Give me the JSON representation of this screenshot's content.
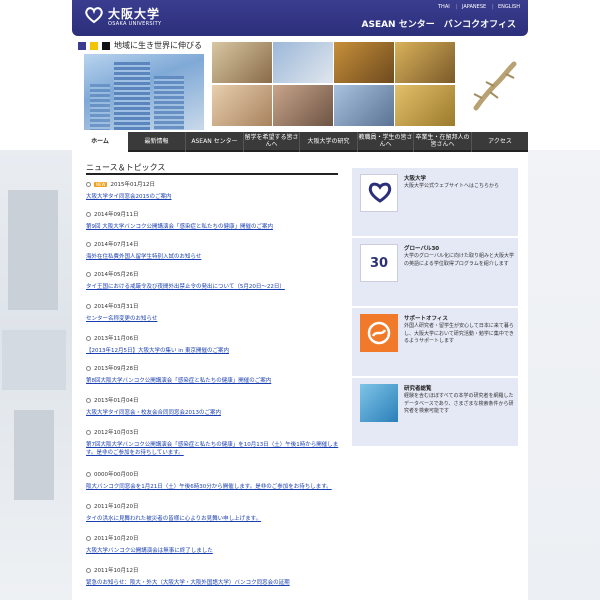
{
  "header": {
    "logo_ja": "大阪大学",
    "logo_en": "OSAKA UNIVERSITY",
    "lang_links": [
      "THAI",
      "JAPANESE",
      "ENGLISH"
    ],
    "title": "ASEAN センター　バンコクオフィス"
  },
  "hero": {
    "slogan": "地域に生き世界に伸びる",
    "slogan_squares": [
      "#3a3d8f",
      "#f5c400",
      "#111111"
    ]
  },
  "nav": {
    "items": [
      {
        "label": "ホーム",
        "active": true
      },
      {
        "label": "最新情報",
        "active": false
      },
      {
        "label": "ASEAN センター",
        "active": false
      },
      {
        "label": "留学を希望する皆さんへ",
        "active": false
      },
      {
        "label": "大阪大学の研究",
        "active": false
      },
      {
        "label": "教職員・学生の皆さんへ",
        "active": false
      },
      {
        "label": "卒業生・在留邦人の皆さんへ",
        "active": false
      },
      {
        "label": "アクセス",
        "active": false
      }
    ]
  },
  "news": {
    "heading": "ニュース＆トピックス",
    "new_badge": "NEW",
    "items": [
      {
        "date": "2015年01月12日",
        "title": "大阪大学タイ同窓会2015のご案内",
        "is_new": true
      },
      {
        "date": "2014年09月11日",
        "title": "第9回 大阪大学バンコク公開講演会「感染症と私たちの健康」開催のご案内",
        "is_new": false
      },
      {
        "date": "2014年07月14日",
        "title": "海外在住私費外国人留学生特別入試のお知らせ",
        "is_new": false
      },
      {
        "date": "2014年05月26日",
        "title": "タイ王国における戒厳令及び夜間外出禁止令の発出について（5月20日～22日）",
        "is_new": false
      },
      {
        "date": "2014年03月31日",
        "title": "センター名称変更のお知らせ",
        "is_new": false
      },
      {
        "date": "2013年11月06日",
        "title": "【2013年12月5日】大阪大学の集い in 東京開催のご案内",
        "is_new": false
      },
      {
        "date": "2013年09月28日",
        "title": "第8回大阪大学バンコク公開講演会「感染症と私たちの健康」開催のご案内",
        "is_new": false
      },
      {
        "date": "2013年01月04日",
        "title": "大阪大学タイ同窓会・校友会合同同窓会2013のご案内",
        "is_new": false
      },
      {
        "date": "2012年10月03日",
        "title": "第7回大阪大学バンコク公開講演会「感染症と私たちの健康」を10月13日（土）午後1時から開催します。是非のご参加をお待ちしています。",
        "is_new": false
      },
      {
        "date": "0000年00月00日",
        "title": "阪大バンコク同窓会を1月21日（土）午後6時30分から開催します。是非のご参加をお待ちします。",
        "is_new": false
      },
      {
        "date": "2011年10月20日",
        "title": "タイの洪水に見舞われた被災者の皆様に心よりお見舞い申し上げます。",
        "is_new": false
      },
      {
        "date": "2011年10月20日",
        "title": "大阪大学バンコク公開講演会は無事に終了しました",
        "is_new": false
      },
      {
        "date": "2011年10月12日",
        "title": "緊急のお知らせ：阪大・外大（大阪大学・大阪外国語大学）バンコク同窓会の延期",
        "is_new": false
      }
    ]
  },
  "sidebar": [
    {
      "title": "大阪大学",
      "text": "大阪大学公式ウェブサイトへはこちらから",
      "img_label": "OSAKA UNIVERSITY"
    },
    {
      "title": "グローバル30",
      "text": "大学のグローバル化に向けた取り組みと大阪大学の英語による学位取得プログラムを紹介します",
      "img_label": "30"
    },
    {
      "title": "サポートオフィス",
      "text": "外国人研究者・留学生が安心して日本に来て暮らし、大阪大学において研究活動・勉学に集中できるようサポートします",
      "img_label": ""
    },
    {
      "title": "研究者総覧",
      "text": "経験を含むほぼすべての本学の研究者を網羅したデータベースであり、さまざまな検索条件から研究者を検索可能です",
      "img_label": ""
    }
  ]
}
